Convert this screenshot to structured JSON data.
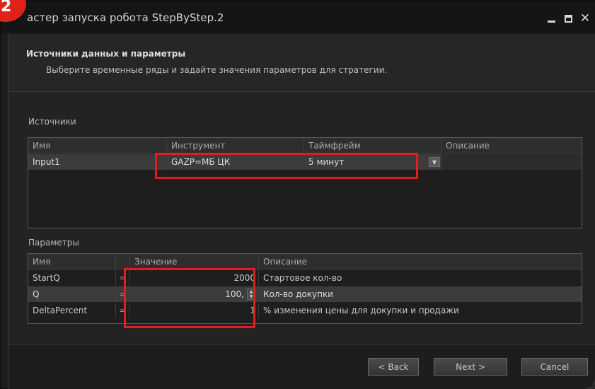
{
  "step_badge": "2",
  "window": {
    "title": "астер запуска робота StepByStep.2"
  },
  "header": {
    "title": "Источники данных и параметры",
    "subtitle": "Выберите временные ряды и задайте значения параметров для стратегии."
  },
  "sources": {
    "label": "Источники",
    "columns": [
      "Имя",
      "Инструмент",
      "Таймфрейм",
      "Описание"
    ],
    "rows": [
      {
        "name": "Input1",
        "instrument": "GAZP=МБ ЦК",
        "timeframe": "5 минут",
        "description": ""
      }
    ]
  },
  "params": {
    "label": "Параметры",
    "columns": [
      "Имя",
      "",
      "Значение",
      "Описание"
    ],
    "rows": [
      {
        "name": "StartQ",
        "eq": "=",
        "value": "2000",
        "description": "Стартовое кол-во"
      },
      {
        "name": "Q",
        "eq": "=",
        "value": "100,",
        "description": "Кол-во докупки"
      },
      {
        "name": "DeltaPercent",
        "eq": "=",
        "value": "1",
        "description": "% изменения цены для докупки и продажи"
      }
    ]
  },
  "footer": {
    "back_label": "< Back",
    "next_label": "Next >",
    "cancel_label": "Cancel"
  },
  "icons": {
    "dropdown": "chevron-down-icon",
    "spinner": "spinner-icon",
    "minimize": "minimize-icon",
    "maximize": "maximize-icon",
    "close": "close-icon"
  },
  "colors": {
    "highlight": "#e41c1c",
    "badge": "#e0231a",
    "background": "#1d1d1d"
  }
}
